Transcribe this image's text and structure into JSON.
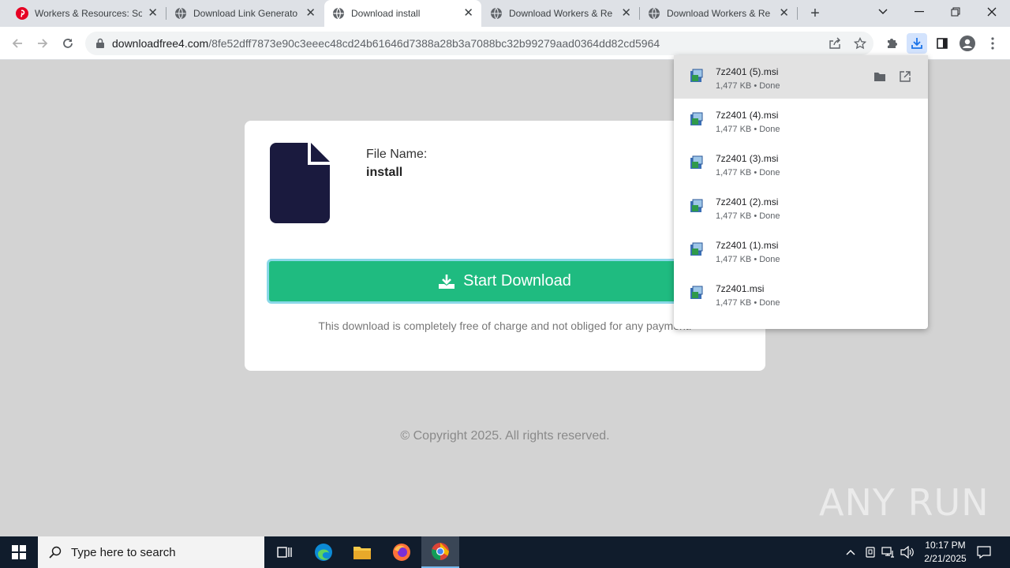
{
  "tabs": [
    {
      "title": "Workers & Resources: So",
      "icon": "pinterest-icon"
    },
    {
      "title": "Download Link Generato",
      "icon": "globe-icon"
    },
    {
      "title": "Download install",
      "icon": "globe-icon",
      "active": true
    },
    {
      "title": "Download Workers & Re",
      "icon": "globe-icon"
    },
    {
      "title": "Download Workers & Re",
      "icon": "globe-icon"
    }
  ],
  "address": {
    "domain": "downloadfree4.com",
    "path": "/8fe52dff7873e90c3eeec48cd24b61646d7388a28b3a7088bc32b99279aad0364dd82cd5964"
  },
  "page": {
    "file_label": "File Name:",
    "file_name": "install",
    "download_button": "Start Download",
    "note": "This download is completely free of charge and not obliged for any payment.",
    "copyright": "© Copyright 2025. All rights reserved."
  },
  "downloads": [
    {
      "name": "7z2401 (5).msi",
      "meta": "1,477 KB • Done"
    },
    {
      "name": "7z2401 (4).msi",
      "meta": "1,477 KB • Done"
    },
    {
      "name": "7z2401 (3).msi",
      "meta": "1,477 KB • Done"
    },
    {
      "name": "7z2401 (2).msi",
      "meta": "1,477 KB • Done"
    },
    {
      "name": "7z2401 (1).msi",
      "meta": "1,477 KB • Done"
    },
    {
      "name": "7z2401.msi",
      "meta": "1,477 KB • Done"
    }
  ],
  "watermark": "ANY RUN",
  "taskbar": {
    "search_placeholder": "Type here to search",
    "time": "10:17 PM",
    "date": "2/21/2025"
  },
  "colors": {
    "accent": "#1fbb80",
    "file_icon": "#1a1a3e",
    "tabstrip": "#dee1e6"
  }
}
